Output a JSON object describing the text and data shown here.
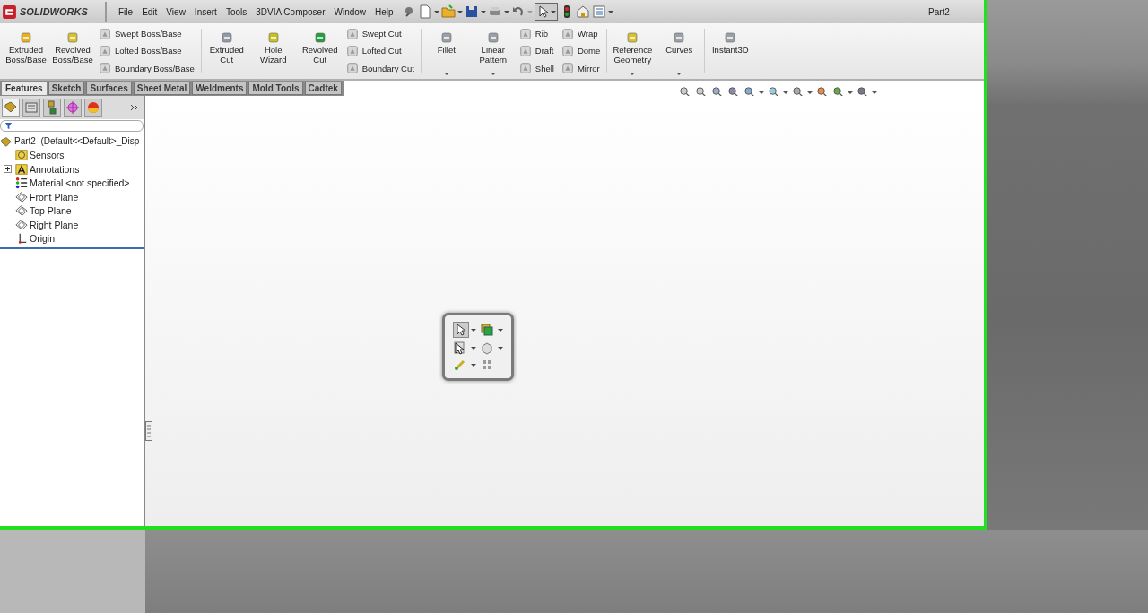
{
  "window": {
    "app_name": "SOLIDWORKS",
    "title": "Part2"
  },
  "menu": [
    "File",
    "Edit",
    "View",
    "Insert",
    "Tools",
    "3DVIA Composer",
    "Window",
    "Help"
  ],
  "ribbon": [
    {
      "kind": "large",
      "items": [
        {
          "label": "Extruded Boss/Base",
          "dropdown": false
        },
        {
          "label": "Revolved Boss/Base",
          "dropdown": false
        }
      ]
    },
    {
      "kind": "small",
      "items": [
        {
          "label": "Swept Boss/Base"
        },
        {
          "label": "Lofted Boss/Base"
        },
        {
          "label": "Boundary Boss/Base"
        }
      ]
    },
    {
      "kind": "large",
      "items": [
        {
          "label": "Extruded Cut",
          "dropdown": false
        },
        {
          "label": "Hole Wizard",
          "dropdown": false
        },
        {
          "label": "Revolved Cut",
          "dropdown": false
        }
      ]
    },
    {
      "kind": "small",
      "items": [
        {
          "label": "Swept Cut"
        },
        {
          "label": "Lofted Cut"
        },
        {
          "label": "Boundary Cut"
        }
      ]
    },
    {
      "kind": "large",
      "items": [
        {
          "label": "Fillet",
          "dropdown": true
        },
        {
          "label": "Linear Pattern",
          "dropdown": true
        }
      ]
    },
    {
      "kind": "small",
      "items": [
        {
          "label": "Rib"
        },
        {
          "label": "Draft"
        },
        {
          "label": "Shell"
        }
      ]
    },
    {
      "kind": "small",
      "items": [
        {
          "label": "Wrap"
        },
        {
          "label": "Dome"
        },
        {
          "label": "Mirror"
        }
      ]
    },
    {
      "kind": "large",
      "items": [
        {
          "label": "Reference Geometry",
          "dropdown": true
        },
        {
          "label": "Curves",
          "dropdown": true
        }
      ]
    },
    {
      "kind": "large",
      "items": [
        {
          "label": "Instant3D",
          "dropdown": false
        }
      ]
    }
  ],
  "tabs": [
    {
      "label": "Features",
      "selected": true
    },
    {
      "label": "Sketch",
      "selected": false
    },
    {
      "label": "Surfaces",
      "selected": false
    },
    {
      "label": "Sheet Metal",
      "selected": false
    },
    {
      "label": "Weldments",
      "selected": false
    },
    {
      "label": "Mold Tools",
      "selected": false
    },
    {
      "label": "Cadtek",
      "selected": false
    }
  ],
  "feature_tree": {
    "root": "Part2  (Default<<Default>_Disp",
    "children": [
      {
        "label": "Sensors",
        "kind": "sensor",
        "collapsed": false
      },
      {
        "label": "Annotations",
        "kind": "annotation",
        "collapsed": true
      },
      {
        "label": "Material <not specified>",
        "kind": "material",
        "collapsed": false
      },
      {
        "label": "Front Plane",
        "kind": "plane",
        "collapsed": false
      },
      {
        "label": "Top Plane",
        "kind": "plane",
        "collapsed": false
      },
      {
        "label": "Right Plane",
        "kind": "plane",
        "collapsed": false
      },
      {
        "label": "Origin",
        "kind": "origin",
        "collapsed": false
      }
    ]
  }
}
